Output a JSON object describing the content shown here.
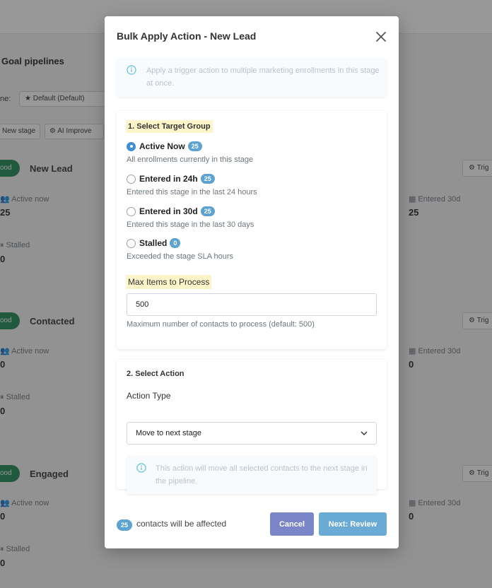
{
  "background": {
    "page_title": "Goal pipelines",
    "pipeline_label": "ne:",
    "pipeline_select": "★ Default (Default)",
    "buttons": {
      "new_stage": "New stage",
      "ai_improve": "AI Improve"
    },
    "stages": [
      {
        "badge": "ood",
        "name": "New Lead",
        "trigger_label": "Trig",
        "active_now_label": "Active now",
        "active_now_value": "25",
        "entered_30d_label": "Entered 30d",
        "entered_30d_value": "25",
        "stalled_label": "Stalled",
        "stalled_value": "0"
      },
      {
        "badge": "ood",
        "name": "Contacted",
        "trigger_label": "Trig",
        "active_now_label": "Active now",
        "active_now_value": "0",
        "entered_30d_label": "Entered 30d",
        "entered_30d_value": "0",
        "stalled_label": "Stalled",
        "stalled_value": "0"
      },
      {
        "badge": "ood",
        "name": "Engaged",
        "trigger_label": "Trig",
        "active_now_label": "Active now",
        "active_now_value": "0",
        "entered_30d_label": "Entered 30d",
        "entered_30d_value": "0",
        "stalled_label": "Stalled",
        "stalled_value": "0"
      }
    ]
  },
  "modal": {
    "title": "Bulk Apply Action - New Lead",
    "info_text": "Apply a trigger action to multiple marketing enrollments in this stage at once.",
    "target_group": {
      "title": "1. Select Target Group",
      "options": [
        {
          "label": "Active Now",
          "count": "25",
          "description": "All enrollments currently in this stage",
          "checked": true
        },
        {
          "label": "Entered in 24h",
          "count": "25",
          "description": "Entered this stage in the last 24 hours",
          "checked": false
        },
        {
          "label": "Entered in 30d",
          "count": "25",
          "description": "Entered this stage in the last 30 days",
          "checked": false
        },
        {
          "label": "Stalled",
          "count": "0",
          "description": "Exceeded the stage SLA hours",
          "checked": false
        }
      ],
      "max_items_label": "Max Items to Process",
      "max_items_value": "500",
      "max_items_help": "Maximum number of contacts to process (default: 500)"
    },
    "action": {
      "title": "2. Select Action",
      "type_label": "Action Type",
      "type_value": "Move to next stage",
      "info_text": "This action will move all selected contacts to the next stage in the pipeline."
    },
    "footer": {
      "count": "25",
      "text": "contacts will be affected",
      "cancel_label": "Cancel",
      "next_label": "Next: Review"
    }
  },
  "colors": {
    "primary": "#3f8fd8",
    "badge": "#5ca3d1",
    "cancel": "#7b86c8",
    "next": "#6aabd6",
    "highlight": "#fdf5c9",
    "success": "#198754"
  }
}
